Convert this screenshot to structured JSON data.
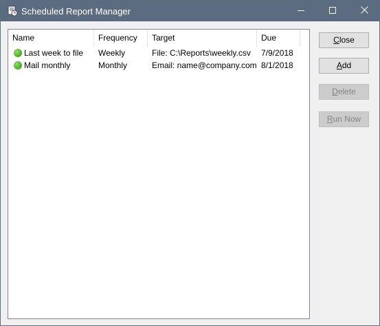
{
  "window": {
    "title": "Scheduled Report Manager",
    "icons": {
      "app": "report-scheduler-icon",
      "minimize": "minimize-icon",
      "maximize": "maximize-icon",
      "close": "close-icon"
    }
  },
  "list": {
    "columns": [
      "Name",
      "Frequency",
      "Target",
      "Due"
    ],
    "rows": [
      {
        "name": "Last week to file",
        "frequency": "Weekly",
        "target": "File: C:\\Reports\\weekly.csv",
        "due": "7/9/2018",
        "status_icon": "active-status-icon",
        "status_color": "#52b52f"
      },
      {
        "name": "Mail monthly",
        "frequency": "Monthly",
        "target": "Email: name@company.com",
        "due": "8/1/2018",
        "status_icon": "active-status-icon",
        "status_color": "#52b52f"
      }
    ]
  },
  "buttons": {
    "close": {
      "mnemonic": "C",
      "rest": "lose",
      "enabled": true
    },
    "add": {
      "mnemonic": "A",
      "rest": "dd",
      "enabled": true
    },
    "delete": {
      "mnemonic": "D",
      "rest": "elete",
      "enabled": false
    },
    "run_now": {
      "mnemonic": "R",
      "rest": "un Now",
      "enabled": false
    }
  },
  "colors": {
    "titlebar": "#5b6b80",
    "dialog_bg": "#f0f0f0",
    "list_border": "#828790",
    "status_green": "#52b52f"
  }
}
